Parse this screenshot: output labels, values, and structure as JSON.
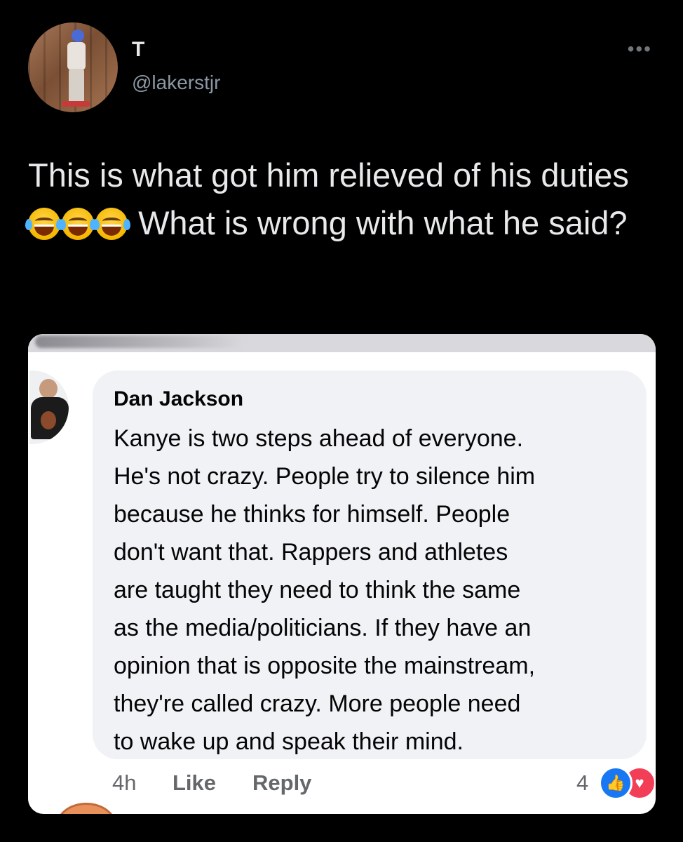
{
  "tweet": {
    "display_name": "T",
    "handle": "@lakerstjr",
    "more_icon": "more-horizontal-icon",
    "text_part1": "This is what got him relieved of his duties",
    "emoji_name": "face-with-tears-of-joy-icon",
    "text_part2": "What is wrong with what he said?"
  },
  "comment": {
    "author": "Dan Jackson",
    "lines": [
      "Kanye is two steps ahead of everyone.",
      "He's not crazy. People try to silence him",
      "because he thinks for himself. People",
      "don't want that. Rappers and athletes",
      "are taught they need to think the same",
      "as the media/politicians. If they have an",
      "opinion that is opposite the mainstream,",
      "they're called crazy. More people need",
      "to wake up and speak their mind."
    ],
    "timestamp": "4h",
    "like_label": "Like",
    "reply_label": "Reply",
    "reaction_count": "4",
    "reaction_icons": [
      "like-reaction-icon",
      "love-reaction-icon"
    ],
    "colors": {
      "like": "#1877f2",
      "love": "#f33e58",
      "bubble": "#f0f2f5"
    }
  }
}
